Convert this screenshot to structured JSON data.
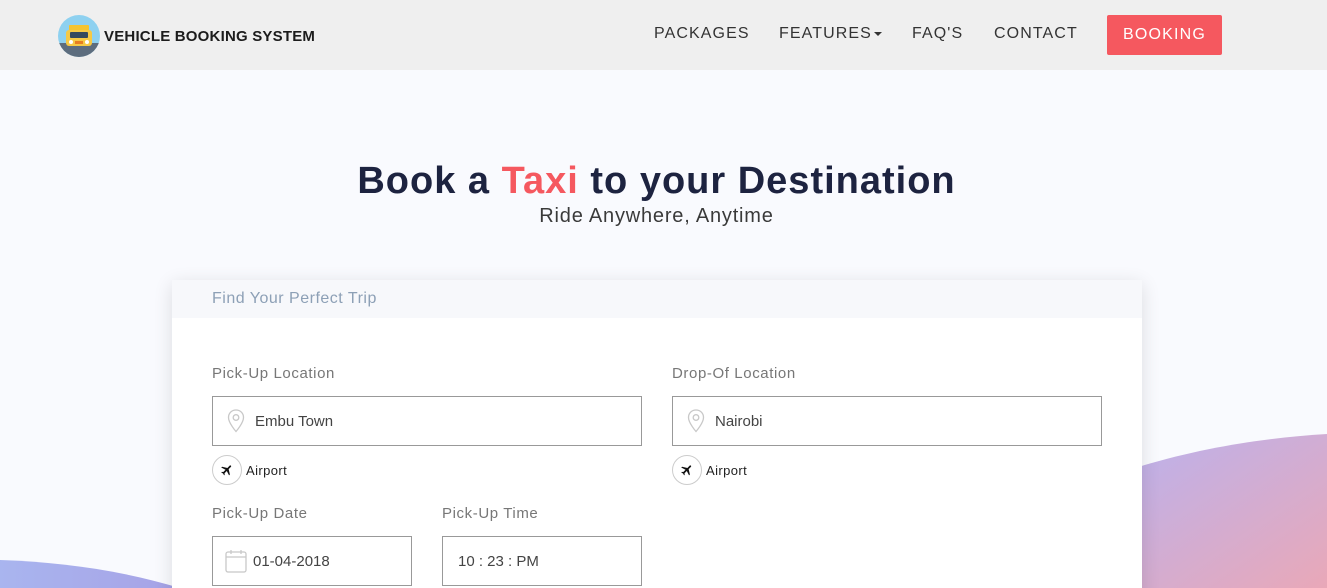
{
  "brand": {
    "name": "VEHICLE BOOKING SYSTEM",
    "logo_icon": "taxi-logo-icon"
  },
  "nav": {
    "items": [
      {
        "label": "PACKAGES"
      },
      {
        "label": "FEATURES"
      },
      {
        "label": "FAQ'S"
      },
      {
        "label": "CONTACT"
      }
    ],
    "booking_label": "BOOKING"
  },
  "hero": {
    "title_pre": "Book a",
    "title_accent": "Taxi",
    "title_post": "to your Destination",
    "subtitle": "Ride Anywhere, Anytime"
  },
  "form": {
    "header": "Find Your Perfect Trip",
    "pickup_label": "Pick-Up Location",
    "pickup_value": "Embu Town",
    "dropoff_label": "Drop-Of Location",
    "dropoff_value": "Nairobi",
    "airport_label": "Airport",
    "date_label": "Pick-Up Date",
    "date_value": "01-04-2018",
    "time_label": "Pick-Up Time",
    "time_value": "10 : 23 : PM"
  },
  "colors": {
    "accent": "#f5585f",
    "title": "#1d2340",
    "navbar": "#efefef"
  }
}
